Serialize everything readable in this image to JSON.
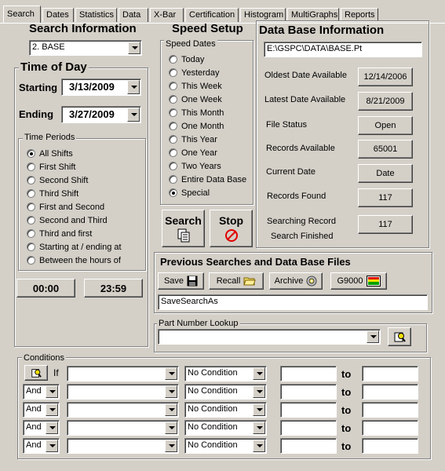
{
  "tabs": [
    "Search",
    "Dates",
    "Statistics",
    "Data",
    "X-Bar",
    "Certification",
    "Histogram",
    "MultiGraphs",
    "Reports"
  ],
  "search_info": {
    "title": "Search Information",
    "selected": "2. BASE"
  },
  "time_of_day": {
    "title": "Time of Day",
    "starting_label": "Starting",
    "starting_value": "3/13/2009",
    "ending_label": "Ending",
    "ending_value": "3/27/2009",
    "periods_label": "Time Periods",
    "periods": [
      "All Shifts",
      "First Shift",
      "Second Shift",
      "Third Shift",
      "First and Second",
      "Second and Third",
      "Third and first",
      "Starting at / ending at",
      "Between the hours of"
    ],
    "selected_period": 0,
    "start_time": "00:00",
    "end_time": "23:59"
  },
  "speed_setup": {
    "title": "Speed Setup",
    "group_label": "Speed Dates",
    "options": [
      "Today",
      "Yesterday",
      "This Week",
      "One Week",
      "This Month",
      "One Month",
      "This Year",
      "One Year",
      "Two Years",
      "Entire Data Base",
      "Special"
    ],
    "selected": 10,
    "search_label": "Search",
    "stop_label": "Stop"
  },
  "db_info": {
    "title": "Data Base Information",
    "path": "E:\\GSPC\\DATA\\BASE.Pt",
    "oldest_label": "Oldest Date Available",
    "oldest_value": "12/14/2006",
    "latest_label": "Latest Date Available",
    "latest_value": "8/21/2009",
    "status_label": "File Status",
    "status_value": "Open",
    "records_label": "Records Available",
    "records_value": "65001",
    "current_label": "Current Date",
    "current_value": "Date",
    "found_label": "Records Found",
    "found_value": "117",
    "searching_label": "Searching Record",
    "finished_label": "Search Finished",
    "searching_value": "117"
  },
  "previous": {
    "title": "Previous Searches and Data Base Files",
    "save": "Save",
    "recall": "Recall",
    "archive": "Archive",
    "g9000": "G9000",
    "filename": "SaveSearchAs"
  },
  "part_lookup": {
    "label": "Part Number Lookup",
    "value": ""
  },
  "conditions": {
    "label": "Conditions",
    "if_label": "If",
    "to_label": "to",
    "rows": [
      {
        "op": "",
        "cond": "No Condition"
      },
      {
        "op": "And",
        "cond": "No Condition"
      },
      {
        "op": "And",
        "cond": "No Condition"
      },
      {
        "op": "And",
        "cond": "No Condition"
      },
      {
        "op": "And",
        "cond": "No Condition"
      }
    ]
  }
}
